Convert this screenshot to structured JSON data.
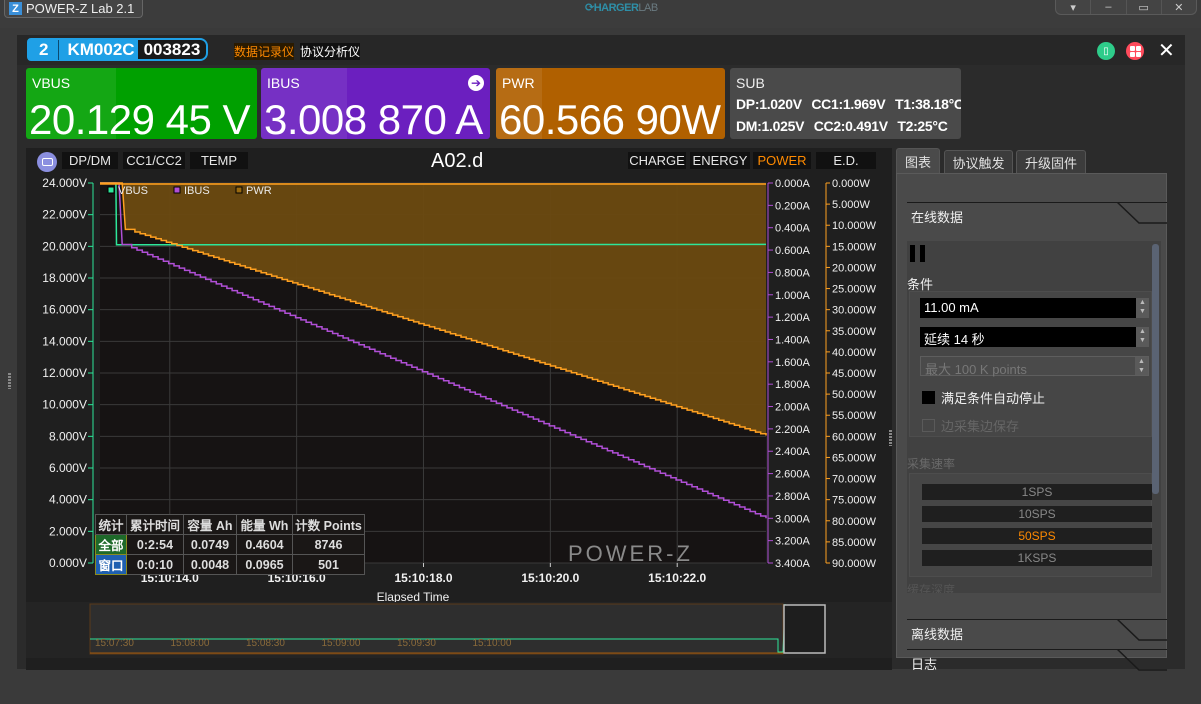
{
  "window": {
    "app_title": "POWER-Z Lab 2.1",
    "brand_main": "HARGER",
    "brand_sub": "LAB",
    "controls": [
      "▾",
      "–",
      "▭",
      "✕"
    ]
  },
  "device": {
    "index": "2",
    "model": "KM002C",
    "serial": "003823",
    "modes": [
      "数据记录仪",
      "协议分析仪"
    ],
    "active_mode": "数据记录仪"
  },
  "readouts": {
    "vbus": {
      "label": "VBUS",
      "value": "20.129 45 V",
      "color": "#00a000"
    },
    "ibus": {
      "label": "IBUS",
      "value": "3.008 870 A",
      "color": "#6b1fbf"
    },
    "pwr": {
      "label": "PWR",
      "value": "60.566 90W",
      "color": "#b06000"
    },
    "sub": {
      "label": "SUB",
      "row1": "DP:1.020V CC1:1.969V T1:38.18°C",
      "row2": "DM:1.025V CC2:0.491V T2:25°C"
    }
  },
  "chart_toolbar": {
    "left_chips": [
      "DP/DM",
      "CC1/CC2",
      "TEMP"
    ],
    "title": "A02.d",
    "right_chips": [
      "CHARGE",
      "ENERGY",
      "POWER",
      "E.D."
    ],
    "active_right": "POWER"
  },
  "stats": {
    "headers": [
      "统计",
      "累计时间",
      "容量 Ah",
      "能量 Wh",
      "计数 Points"
    ],
    "rows": [
      {
        "label": "全部",
        "time": "0:2:54",
        "ah": "0.0749",
        "wh": "0.4604",
        "points": "8746"
      },
      {
        "label": "窗口",
        "time": "0:0:10",
        "ah": "0.0048",
        "wh": "0.0965",
        "points": "501"
      }
    ]
  },
  "watermark": "POWER-Z",
  "overview": {
    "ticks": [
      "15:07:30",
      "15:08:00",
      "15:08:30",
      "15:09:00",
      "15:09:30",
      "15:10:00"
    ]
  },
  "side_panel": {
    "tabs": [
      "图表",
      "协议触发",
      "升级固件"
    ],
    "active_tab": "图表",
    "sections": [
      "在线数据",
      "离线数据",
      "日志"
    ],
    "condition_label": "条件",
    "threshold": "11.00 mA",
    "duration": "延续 14 秒",
    "max_points_placeholder": "最大 100 K points",
    "auto_stop_label": "满足条件自动停止",
    "auto_stop_checked": true,
    "save_while_label": "边采集边保存",
    "rate_label": "采集速率",
    "rates": [
      "1SPS",
      "10SPS",
      "50SPS",
      "1KSPS"
    ],
    "selected_rate": "50SPS",
    "depth_label": "缓存深度"
  },
  "chart_data": {
    "type": "line",
    "title": "A02.d",
    "xlabel": "Elapsed Time",
    "x_ticks": [
      "15:10:14.0",
      "15:10:16.0",
      "15:10:18.0",
      "15:10:20.0",
      "15:10:22.0"
    ],
    "x_range_seconds": [
      12.9,
      23.4
    ],
    "legend": [
      "VBUS",
      "IBUS",
      "PWR"
    ],
    "legend_position": "top-left",
    "axes": {
      "vbus": {
        "unit": "V",
        "range": [
          0,
          24
        ],
        "ticks": [
          "0.000V",
          "2.000V",
          "4.000V",
          "6.000V",
          "8.000V",
          "10.000V",
          "12.000V",
          "14.000V",
          "16.000V",
          "18.000V",
          "20.000V",
          "22.000V",
          "24.000V"
        ],
        "color": "#2ee69a",
        "side": "left"
      },
      "ibus": {
        "unit": "A",
        "range": [
          0,
          3.4
        ],
        "inverted": true,
        "ticks": [
          "0.000A",
          "0.200A",
          "0.400A",
          "0.600A",
          "0.800A",
          "1.000A",
          "1.200A",
          "1.400A",
          "1.600A",
          "1.800A",
          "2.000A",
          "2.200A",
          "2.400A",
          "2.600A",
          "2.800A",
          "3.000A",
          "3.200A",
          "3.400A"
        ],
        "color": "#b04fd6",
        "side": "right"
      },
      "pwr": {
        "unit": "W",
        "range": [
          0,
          90
        ],
        "inverted": true,
        "ticks": [
          "0.000W",
          "5.000W",
          "10.000W",
          "15.000W",
          "20.000W",
          "25.000W",
          "30.000W",
          "35.000W",
          "40.000W",
          "45.000W",
          "50.000W",
          "55.000W",
          "60.000W",
          "65.000W",
          "70.000W",
          "75.000W",
          "80.000W",
          "85.000W",
          "90.000W"
        ],
        "color": "#ffa020",
        "side": "right"
      }
    },
    "series": [
      {
        "name": "VBUS",
        "color": "#2ee69a",
        "x": [
          12.9,
          13.15,
          13.16,
          23.4
        ],
        "values": [
          24.0,
          24.0,
          20.1,
          20.12
        ]
      },
      {
        "name": "IBUS",
        "color": "#b04fd6",
        "x": [
          12.9,
          13.2,
          13.25,
          13.4,
          23.4
        ],
        "values": [
          0.0,
          0.0,
          0.55,
          0.58,
          3.0
        ]
      },
      {
        "name": "PWR",
        "color": "#ffa020",
        "x": [
          12.9,
          13.25,
          13.3,
          13.45,
          23.4
        ],
        "values": [
          0.0,
          0.0,
          11.0,
          11.6,
          59.8
        ]
      }
    ]
  }
}
